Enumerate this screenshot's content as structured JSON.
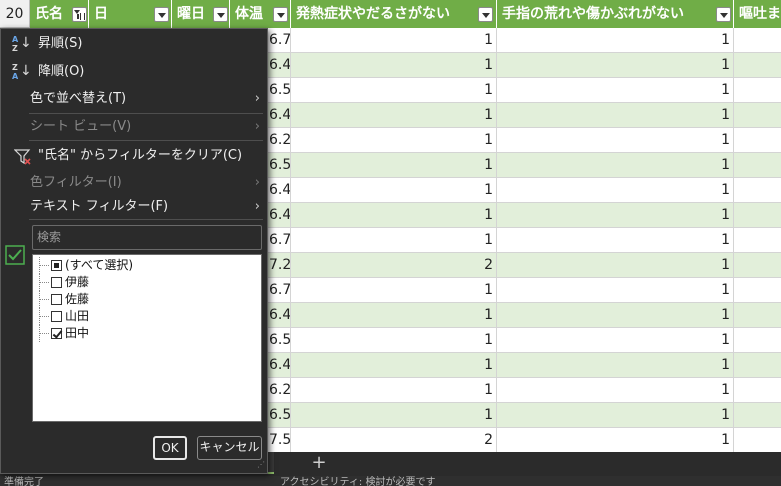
{
  "header": {
    "row_number": "20",
    "columns": [
      {
        "label": "氏名",
        "filtered": true
      },
      {
        "label": "日",
        "filtered": false
      },
      {
        "label": "曜日",
        "filtered": false
      },
      {
        "label": "体温",
        "filtered": false
      },
      {
        "label": "発熱症状やだるさがない",
        "filtered": false
      },
      {
        "label": "手指の荒れや傷かぶれがない",
        "filtered": false
      },
      {
        "label": "嘔吐ま",
        "filtered": false
      }
    ]
  },
  "rows": [
    {
      "temp": "6.7",
      "c1": "1",
      "c2": "1"
    },
    {
      "temp": "6.4",
      "c1": "1",
      "c2": "1"
    },
    {
      "temp": "6.5",
      "c1": "1",
      "c2": "1"
    },
    {
      "temp": "6.4",
      "c1": "1",
      "c2": "1"
    },
    {
      "temp": "6.2",
      "c1": "1",
      "c2": "1"
    },
    {
      "temp": "6.5",
      "c1": "1",
      "c2": "1"
    },
    {
      "temp": "6.4",
      "c1": "1",
      "c2": "1"
    },
    {
      "temp": "6.4",
      "c1": "1",
      "c2": "1"
    },
    {
      "temp": "6.7",
      "c1": "1",
      "c2": "1"
    },
    {
      "temp": "7.2",
      "c1": "2",
      "c2": "1"
    },
    {
      "temp": "6.7",
      "c1": "1",
      "c2": "1"
    },
    {
      "temp": "6.4",
      "c1": "1",
      "c2": "1"
    },
    {
      "temp": "6.5",
      "c1": "1",
      "c2": "1"
    },
    {
      "temp": "6.4",
      "c1": "1",
      "c2": "1"
    },
    {
      "temp": "6.2",
      "c1": "1",
      "c2": "1"
    },
    {
      "temp": "6.5",
      "c1": "1",
      "c2": "1"
    },
    {
      "temp": "7.5",
      "c1": "2",
      "c2": "1"
    }
  ],
  "menu": {
    "sort_asc": "昇順(S)",
    "sort_desc": "降順(O)",
    "sort_by_color": "色で並べ替え(T)",
    "sheet_view": "シート ビュー(V)",
    "clear_filter": "\"氏名\" からフィルターをクリア(C)",
    "color_filter": "色フィルター(I)",
    "text_filter": "テキスト フィルター(F)",
    "search_placeholder": "検索",
    "items": [
      {
        "label": "(すべて選択)",
        "state": "partial"
      },
      {
        "label": "伊藤",
        "state": "unchecked"
      },
      {
        "label": "佐藤",
        "state": "unchecked"
      },
      {
        "label": "山田",
        "state": "unchecked"
      },
      {
        "label": "田中",
        "state": "checked"
      }
    ],
    "ok": "OK",
    "cancel": "キャンセル"
  },
  "status": {
    "add_sheet": "+",
    "left": "準備完了",
    "middle": "アクセシビリティ: 検討が必要です"
  },
  "colors": {
    "header_green": "#70ad47",
    "band_green": "#e2efda",
    "menu_bg": "#2b2b2b",
    "check_green": "#4caf50"
  },
  "icons": [
    "sort-ascending-icon",
    "sort-descending-icon",
    "submenu-arrow-icon",
    "clear-filter-icon",
    "filter-checkbox-icon",
    "resize-grip-icon"
  ]
}
